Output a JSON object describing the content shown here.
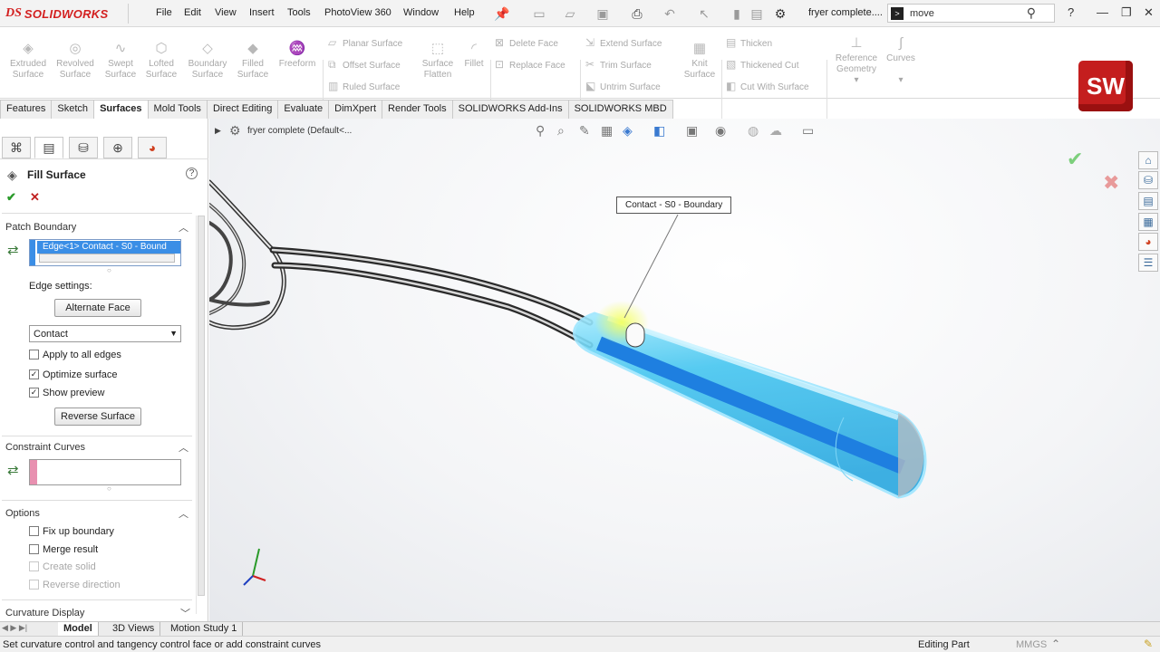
{
  "app": {
    "logo_mark": "DS",
    "logo_text": "SOLIDWORKS",
    "doc_name": "fryer complete....",
    "search_value": "move",
    "sw_badge": "SW"
  },
  "menu": [
    "File",
    "Edit",
    "View",
    "Insert",
    "Tools",
    "PhotoView 360",
    "Window",
    "Help"
  ],
  "ribbon": {
    "big": [
      {
        "label1": "Extruded",
        "label2": "Surface"
      },
      {
        "label1": "Revolved",
        "label2": "Surface"
      },
      {
        "label1": "Swept",
        "label2": "Surface"
      },
      {
        "label1": "Lofted",
        "label2": "Surface"
      },
      {
        "label1": "Boundary",
        "label2": "Surface"
      },
      {
        "label1": "Filled",
        "label2": "Surface"
      },
      {
        "label1": "Freeform",
        "label2": ""
      }
    ],
    "col1": [
      "Planar Surface",
      "Offset Surface",
      "Ruled Surface"
    ],
    "flatten": {
      "label1": "Surface",
      "label2": "Flatten"
    },
    "fillet": "Fillet",
    "col2": [
      "Delete Face",
      "Replace Face"
    ],
    "col3": [
      "Extend Surface",
      "Trim Surface",
      "Untrim Surface"
    ],
    "knit": {
      "label1": "Knit",
      "label2": "Surface"
    },
    "col4": [
      "Thicken",
      "Thickened Cut",
      "Cut With Surface"
    ],
    "refgeo": {
      "label1": "Reference",
      "label2": "Geometry"
    },
    "curves": "Curves"
  },
  "tabs": [
    "Features",
    "Sketch",
    "Surfaces",
    "Mold Tools",
    "Direct Editing",
    "Evaluate",
    "DimXpert",
    "Render Tools",
    "SOLIDWORKS Add-Ins",
    "SOLIDWORKS MBD"
  ],
  "active_tab": "Surfaces",
  "tree_header": "fryer complete  (Default<...",
  "panel": {
    "title": "Fill Surface",
    "patch_boundary": {
      "title": "Patch Boundary",
      "selection": "Edge<1> Contact - S0 - Bound",
      "edge_settings_label": "Edge settings:",
      "alternate_face": "Alternate Face",
      "condition": "Contact",
      "apply_all": "Apply to all edges",
      "optimize": "Optimize surface",
      "show_preview": "Show preview",
      "reverse_surface": "Reverse Surface"
    },
    "constraint_curves": {
      "title": "Constraint Curves"
    },
    "options": {
      "title": "Options",
      "fix_up": "Fix up boundary",
      "merge": "Merge result",
      "create_solid": "Create solid",
      "reverse_direction": "Reverse direction"
    },
    "curvature_display": "Curvature Display"
  },
  "tooltip": "Contact - S0 - Boundary",
  "bottom_tabs": [
    "Model",
    "3D Views",
    "Motion Study 1"
  ],
  "status": {
    "message": "Set curvature control and tangency control face or add constraint curves",
    "mode": "Editing Part",
    "units": "MMGS"
  },
  "colors": {
    "accent_blue": "#3ec8f0",
    "selection_blue": "#3a8ee6",
    "sw_red": "#c41e1e"
  }
}
